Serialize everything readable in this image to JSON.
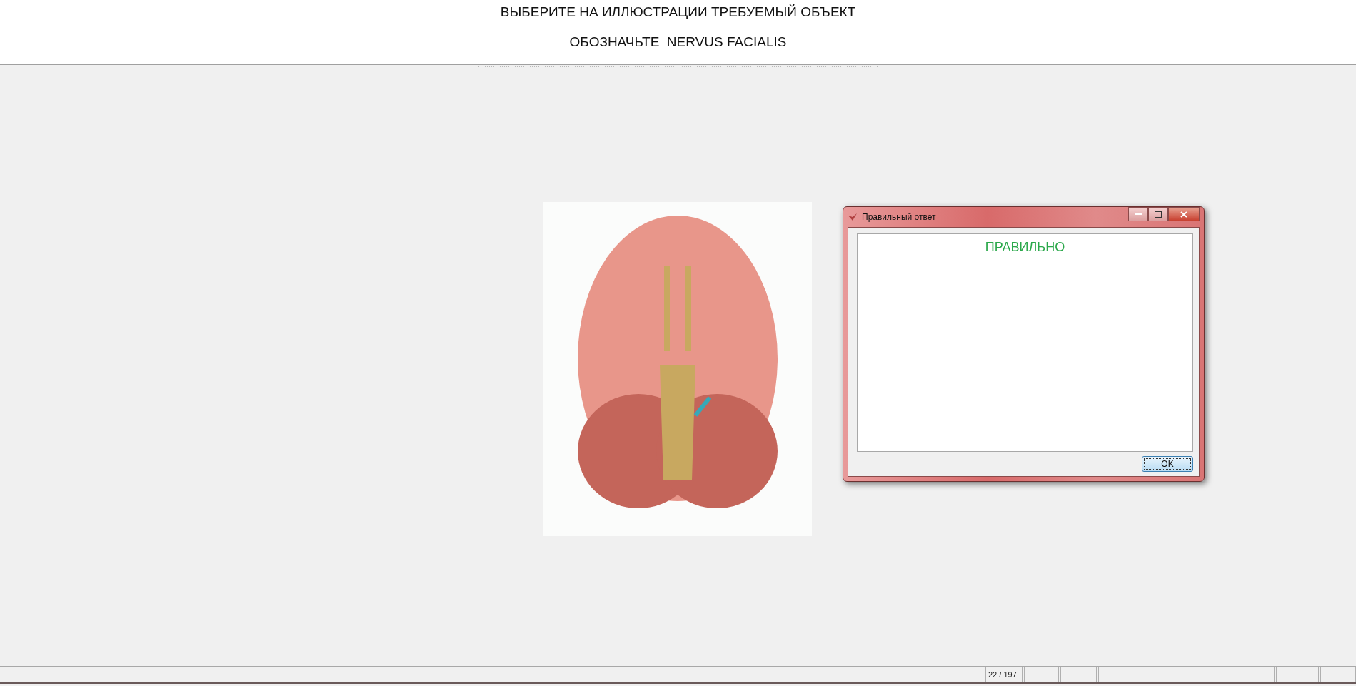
{
  "header": {
    "instruction": "ВЫБЕРИТЕ НА ИЛЛЮСТРАЦИИ ТРЕБУЕМЫЙ ОБЪЕКТ",
    "task": "ОБОЗНАЧЬТЕ  NERVUS FACIALIS"
  },
  "dialog": {
    "title": "Правильный ответ",
    "message": "ПРАВИЛЬНО",
    "button": "OK"
  },
  "status_bar": {
    "page_counter": "22 / 197"
  }
}
